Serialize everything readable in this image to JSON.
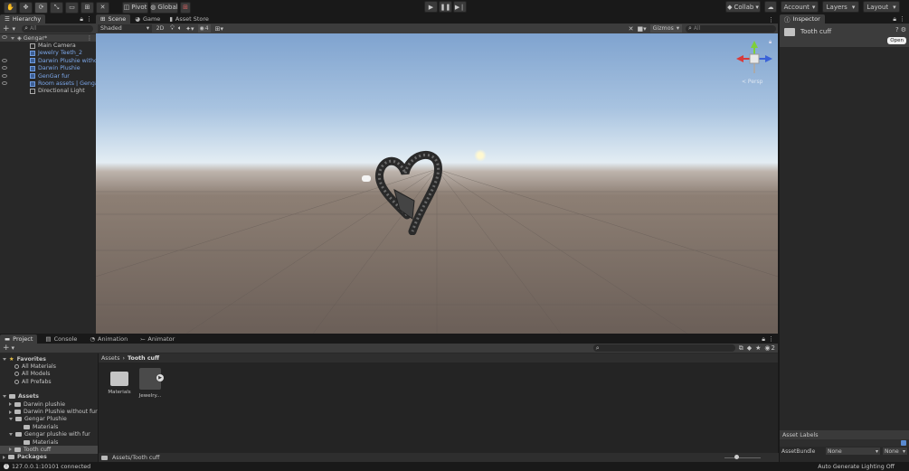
{
  "toolbar": {
    "pivot_label": "Pivot",
    "global_label": "Global",
    "collab_label": "Collab",
    "account_label": "Account",
    "layers_label": "Layers",
    "layout_label": "Layout"
  },
  "hierarchy": {
    "tab_label": "Hierarchy",
    "search_placeholder": "All",
    "scene_name": "Gengar*",
    "items": [
      {
        "label": "Main Camera",
        "style": "normal"
      },
      {
        "label": "Jewelry Teeth_2",
        "style": "prefab"
      },
      {
        "label": "Darwin Plushie without",
        "style": "prefab"
      },
      {
        "label": "Darwin Plushie",
        "style": "prefab"
      },
      {
        "label": "GenGar fur",
        "style": "prefab"
      },
      {
        "label": "Room assets | Gengar",
        "style": "prefab"
      },
      {
        "label": "Directional Light",
        "style": "normal"
      }
    ]
  },
  "scene_view": {
    "tabs": [
      {
        "label": "Scene",
        "active": true
      },
      {
        "label": "Game",
        "active": false
      },
      {
        "label": "Asset Store",
        "active": false
      }
    ],
    "shading_mode": "Shaded",
    "mode_2d": "2D",
    "gizmos_label": "Gizmos",
    "search_placeholder": "All",
    "persp_label": "< Persp",
    "layers_count": "4"
  },
  "inspector": {
    "tab_label": "Inspector",
    "object_name": "Tooth cuff",
    "open_label": "Open",
    "asset_labels_title": "Asset Labels",
    "assetbundle_label": "AssetBundle",
    "assetbundle_value": "None",
    "variant_value": "None"
  },
  "project": {
    "tabs": [
      {
        "label": "Project",
        "active": true
      },
      {
        "label": "Console",
        "active": false
      },
      {
        "label": "Animation",
        "active": false
      },
      {
        "label": "Animator",
        "active": false
      }
    ],
    "hidden_count": "2",
    "favorites_label": "Favorites",
    "favorites": [
      "All Materials",
      "All Models",
      "All Prefabs"
    ],
    "assets_label": "Assets",
    "tree": [
      {
        "label": "Darwin plushie",
        "depth": 1,
        "open": false,
        "selected": false
      },
      {
        "label": "Darwin Plushie without fur",
        "depth": 1,
        "open": false,
        "selected": false
      },
      {
        "label": "Gengar Plushie",
        "depth": 1,
        "open": true,
        "selected": false
      },
      {
        "label": "Materials",
        "depth": 2,
        "open": false,
        "selected": false
      },
      {
        "label": "Gengar plushie with fur",
        "depth": 1,
        "open": true,
        "selected": false
      },
      {
        "label": "Materials",
        "depth": 2,
        "open": false,
        "selected": false
      },
      {
        "label": "Tooth cuff",
        "depth": 1,
        "open": false,
        "selected": true
      }
    ],
    "packages_label": "Packages",
    "breadcrumb": [
      "Assets",
      "Tooth cuff"
    ],
    "grid_items": [
      {
        "label": "Materials",
        "kind": "folder"
      },
      {
        "label": "Jewelry...",
        "kind": "model"
      }
    ],
    "footer_path": "Assets/Tooth cuff"
  },
  "status_bar": {
    "connection": "127.0.0.1:10101 connected",
    "lighting": "Auto Generate Lighting Off"
  }
}
